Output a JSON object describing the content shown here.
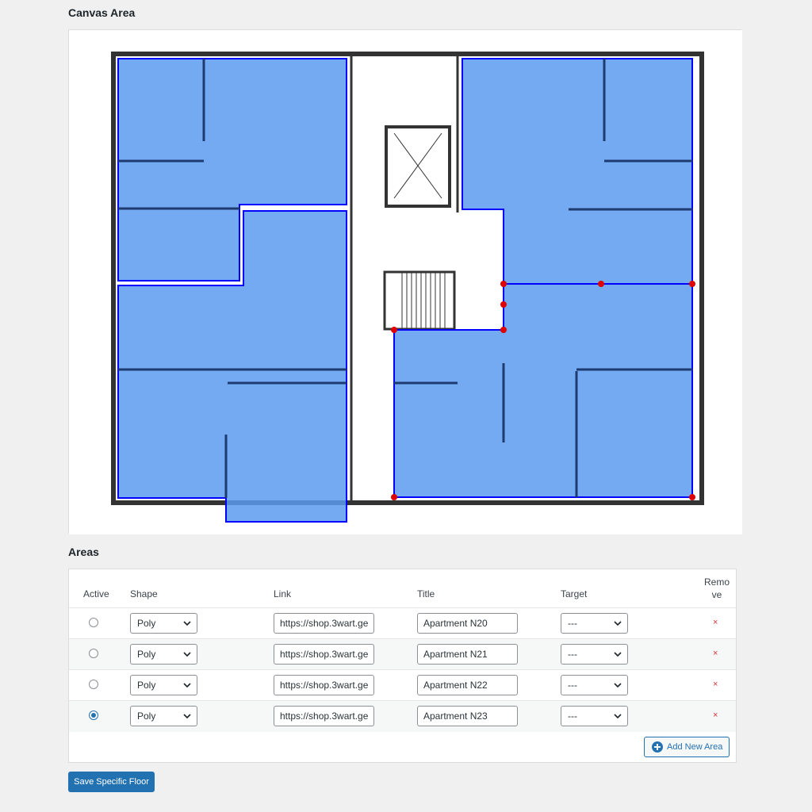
{
  "canvas": {
    "title": "Canvas Area"
  },
  "areas": {
    "title": "Areas",
    "headers": {
      "active": "Active",
      "shape": "Shape",
      "link": "Link",
      "title": "Title",
      "target": "Target",
      "remove": "Remo ve"
    },
    "rows": [
      {
        "active": false,
        "shape": "Poly",
        "link": "https://shop.3wart.ge",
        "title": "Apartment N20",
        "target": "---",
        "remove": "×"
      },
      {
        "active": false,
        "shape": "Poly",
        "link": "https://shop.3wart.ge",
        "title": "Apartment N21",
        "target": "---",
        "remove": "×"
      },
      {
        "active": false,
        "shape": "Poly",
        "link": "https://shop.3wart.ge",
        "title": "Apartment N22",
        "target": "---",
        "remove": "×"
      },
      {
        "active": true,
        "shape": "Poly",
        "link": "https://shop.3wart.ge",
        "title": "Apartment N23",
        "target": "---",
        "remove": "×"
      }
    ],
    "add_button": {
      "label": "Add New Area",
      "icon": "plus-circle-icon"
    }
  },
  "save_button": {
    "label": "Save Specific Floor"
  },
  "colors": {
    "accent": "#2271b1",
    "area_fill": "#5b9bf0",
    "area_stroke": "#0000ff",
    "vertex": "#e00000",
    "remove": "#d63638"
  }
}
